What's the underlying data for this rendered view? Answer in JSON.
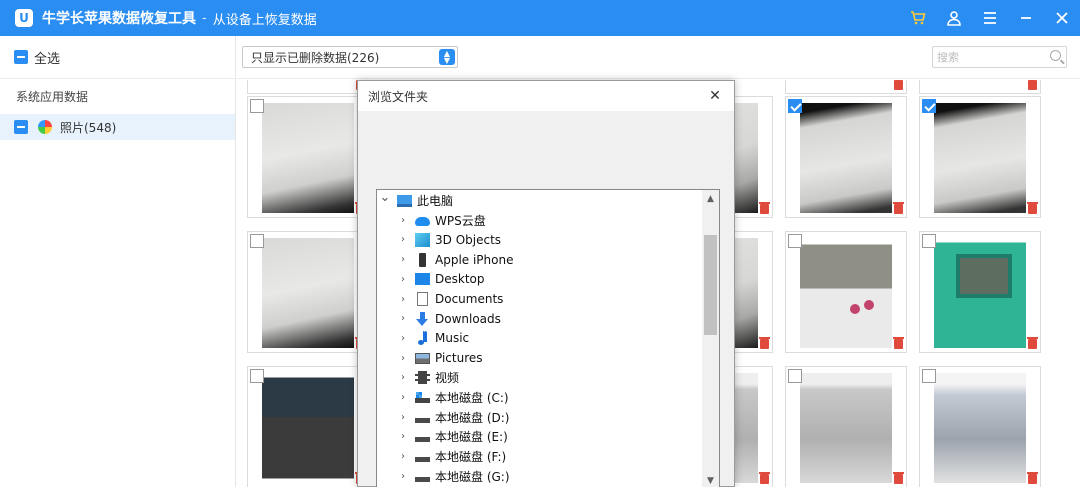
{
  "titlebar": {
    "app_name": "牛学长苹果数据恢复工具",
    "separator": "-",
    "subtitle": "从设备上恢复数据",
    "accent_color": "#2a8df1",
    "icons": [
      "cart-icon",
      "user-icon",
      "menu-icon",
      "minimize-icon",
      "close-icon"
    ]
  },
  "sidebar": {
    "select_all": "全选",
    "section_label": "系统应用数据",
    "items": [
      {
        "label": "照片(548)",
        "icon": "photos-icon"
      }
    ]
  },
  "toolbar": {
    "filter_value": "只显示已删除数据(226)",
    "search_placeholder": "搜索"
  },
  "grid": {
    "cards": [
      {
        "kind": "ph-top-strip",
        "checked": false
      },
      {
        "kind": "ph-top-strip",
        "checked": false
      },
      {
        "kind": "ph-top-strip",
        "checked": false
      },
      {
        "kind": "ph-paper",
        "checked": false
      },
      {
        "kind": "ph-paper3",
        "checked": false
      },
      {
        "kind": "ph-paper2",
        "checked": true
      },
      {
        "kind": "ph-paper2",
        "checked": true
      },
      {
        "kind": "ph-paper",
        "checked": false
      },
      {
        "kind": "ph-paper3",
        "checked": false
      },
      {
        "kind": "ph-gb-white",
        "checked": false
      },
      {
        "kind": "ph-gb-green",
        "checked": false
      },
      {
        "kind": "ph-phone",
        "checked": false
      },
      {
        "kind": "ph-screen",
        "checked": false
      },
      {
        "kind": "ph-screen",
        "checked": false
      },
      {
        "kind": "ph-screen2",
        "checked": false
      }
    ]
  },
  "dialog": {
    "title": "浏览文件夹",
    "close_glyph": "✕",
    "tree": [
      {
        "label": "此电脑",
        "icon": "computer-icon",
        "expanded": true,
        "level": 0
      },
      {
        "label": "WPS云盘",
        "icon": "cloud-icon",
        "level": 1
      },
      {
        "label": "3D Objects",
        "icon": "3d-objects-icon",
        "level": 1
      },
      {
        "label": "Apple iPhone",
        "icon": "iphone-icon",
        "level": 1
      },
      {
        "label": "Desktop",
        "icon": "desktop-icon",
        "level": 1
      },
      {
        "label": "Documents",
        "icon": "documents-icon",
        "level": 1
      },
      {
        "label": "Downloads",
        "icon": "downloads-icon",
        "level": 1
      },
      {
        "label": "Music",
        "icon": "music-icon",
        "level": 1
      },
      {
        "label": "Pictures",
        "icon": "pictures-icon",
        "level": 1
      },
      {
        "label": "视频",
        "icon": "videos-icon",
        "level": 1
      },
      {
        "label": "本地磁盘 (C:)",
        "icon": "system-drive-icon",
        "level": 1
      },
      {
        "label": "本地磁盘 (D:)",
        "icon": "drive-icon",
        "level": 1
      },
      {
        "label": "本地磁盘 (E:)",
        "icon": "drive-icon",
        "level": 1
      },
      {
        "label": "本地磁盘 (F:)",
        "icon": "drive-icon",
        "level": 1
      },
      {
        "label": "本地磁盘 (G:)",
        "icon": "drive-icon",
        "level": 1
      }
    ]
  }
}
